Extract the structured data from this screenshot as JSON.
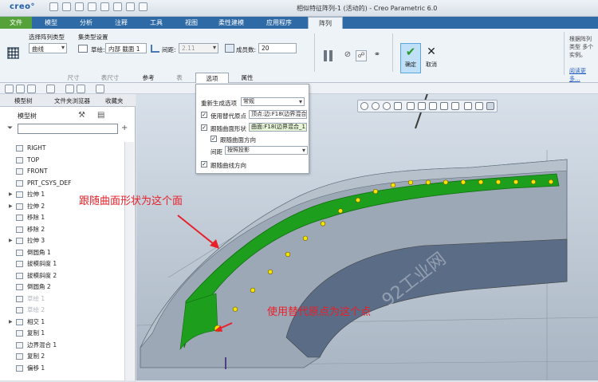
{
  "app": {
    "logo": "creo°",
    "window_title": "相似特征阵列-1 (活动的) - Creo Parametric 6.0"
  },
  "menu": {
    "file": "文件",
    "items": [
      "模型",
      "分析",
      "注释",
      "工具",
      "视图",
      "柔性建模",
      "应用程序"
    ],
    "active": "阵列"
  },
  "ribbon": {
    "pattern_type_label": "选择阵列类型",
    "pattern_type_value": "曲线",
    "set_type_label": "集类型设置",
    "sketch_label": "草绘:",
    "sketch_value": "内部 截面 1",
    "spacing_label": "间距:",
    "spacing_value": "2.11",
    "members_label": "成员数:",
    "members_value": "20",
    "ok_label": "确定",
    "cancel_label": "取消",
    "help_text": "根据阵列类型 多个实例。",
    "help_link": "阅读更多..."
  },
  "subtabs": [
    "尺寸",
    "表尺寸",
    "参考",
    "表",
    "选项",
    "属性"
  ],
  "options_panel": {
    "regen_label": "重新生成选项",
    "regen_value": "常规",
    "alt_origin_label": "使用替代原点",
    "alt_origin_value": "顶点:边:F18(边界混合_1)",
    "follow_surface_label": "跟随曲面形状",
    "follow_surface_value": "曲面:F18(边界混合_1)",
    "follow_surface_dir_label": "跟随曲面方向",
    "spacing_label": "间距",
    "spacing_value": "按照投影",
    "follow_curve_label": "跟随曲线方向"
  },
  "tree": {
    "tabs": [
      "模型树",
      "文件夹浏览器",
      "收藏夹"
    ],
    "title": "模型树",
    "items": [
      {
        "label": "RIGHT",
        "grey": false,
        "exp": false
      },
      {
        "label": "TOP",
        "grey": false,
        "exp": false
      },
      {
        "label": "FRONT",
        "grey": false,
        "exp": false
      },
      {
        "label": "PRT_CSYS_DEF",
        "grey": false,
        "exp": false
      },
      {
        "label": "拉伸 1",
        "grey": false,
        "exp": true
      },
      {
        "label": "拉伸 2",
        "grey": false,
        "exp": true
      },
      {
        "label": "移除 1",
        "grey": false,
        "exp": false
      },
      {
        "label": "移除 2",
        "grey": false,
        "exp": false
      },
      {
        "label": "拉伸 3",
        "grey": false,
        "exp": true
      },
      {
        "label": "倒圆角 1",
        "grey": false,
        "exp": false
      },
      {
        "label": "拔模斜度 1",
        "grey": false,
        "exp": false
      },
      {
        "label": "拔模斜度 2",
        "grey": false,
        "exp": false
      },
      {
        "label": "倒圆角 2",
        "grey": false,
        "exp": false
      },
      {
        "label": "草绘 1",
        "grey": true,
        "exp": false
      },
      {
        "label": "草绘 2",
        "grey": true,
        "exp": false
      },
      {
        "label": "相交 1",
        "grey": false,
        "exp": true
      },
      {
        "label": "复制 1",
        "grey": false,
        "exp": false
      },
      {
        "label": "边界混合 1",
        "grey": false,
        "exp": false
      },
      {
        "label": "复制 2",
        "grey": false,
        "exp": false
      },
      {
        "label": "偏移 1",
        "grey": false,
        "exp": false
      }
    ]
  },
  "annotations": {
    "surface_note": "跟随曲面形状为这个面",
    "origin_note": "使用替代原点为这个点",
    "watermark": "92工业网"
  },
  "colors": {
    "menubar": "#2e6aa6",
    "file_tab": "#55a23a",
    "surface": "#1d9e1d",
    "marker": "#f5e400",
    "note": "#e8202a"
  }
}
